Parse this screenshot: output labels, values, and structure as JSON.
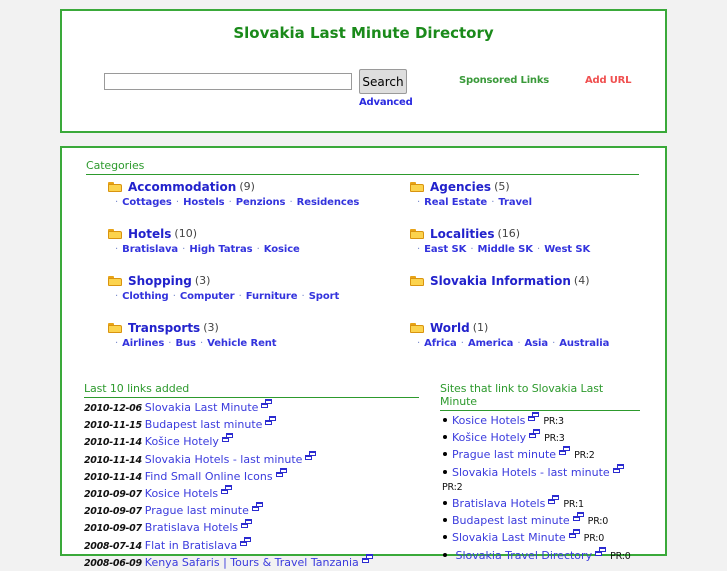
{
  "header": {
    "title": "Slovakia Last Minute Directory",
    "search": {
      "value": "",
      "placeholder": "",
      "button_label": "Search",
      "advanced_label": "Advanced"
    },
    "sponsored_links_label": "Sponsored Links",
    "add_url_label": "Add URL"
  },
  "content": {
    "categories_heading": "Categories",
    "categories_left": [
      {
        "name": "Accommodation",
        "count": "(9)",
        "subcategories": [
          "Cottages",
          "Hostels",
          "Penzions",
          "Residences"
        ]
      },
      {
        "name": "Hotels",
        "count": "(10)",
        "subcategories": [
          "Bratislava",
          "High Tatras",
          "Kosice"
        ]
      },
      {
        "name": "Shopping",
        "count": "(3)",
        "subcategories": [
          "Clothing",
          "Computer",
          "Furniture",
          "Sport"
        ]
      },
      {
        "name": "Transports",
        "count": "(3)",
        "subcategories": [
          "Airlines",
          "Bus",
          "Vehicle Rent"
        ]
      }
    ],
    "categories_right": [
      {
        "name": "Agencies",
        "count": "(5)",
        "subcategories": [
          "Real Estate",
          "Travel"
        ]
      },
      {
        "name": "Localities",
        "count": "(16)",
        "subcategories": [
          "East SK",
          "Middle SK",
          "West SK"
        ]
      },
      {
        "name": "Slovakia Information",
        "count": "(4)",
        "subcategories": []
      },
      {
        "name": "World",
        "count": "(1)",
        "subcategories": [
          "Africa",
          "America",
          "Asia",
          "Australia"
        ]
      }
    ],
    "latest_heading": "Last 10 links added",
    "latest_links": [
      {
        "date": "2010-12-06",
        "title": "Slovakia Last Minute"
      },
      {
        "date": "2010-11-15",
        "title": "Budapest last minute"
      },
      {
        "date": "2010-11-14",
        "title": "Košice Hotely"
      },
      {
        "date": "2010-11-14",
        "title": "Slovakia Hotels - last minute"
      },
      {
        "date": "2010-11-14",
        "title": "Find Small Online Icons"
      },
      {
        "date": "2010-09-07",
        "title": "Kosice Hotels"
      },
      {
        "date": "2010-09-07",
        "title": "Prague last minute"
      },
      {
        "date": "2010-09-07",
        "title": "Bratislava Hotels"
      },
      {
        "date": "2008-07-14",
        "title": "Flat in Bratislava"
      },
      {
        "date": "2008-06-09",
        "title": "Kenya Safaris | Tours & Travel Tanzania"
      }
    ],
    "backlinks_heading": "Sites that link to Slovakia Last Minute",
    "backlinks": [
      {
        "title": "Kosice Hotels",
        "pr": "PR:3"
      },
      {
        "title": "Košice Hotely",
        "pr": "PR:3"
      },
      {
        "title": "Prague last minute",
        "pr": "PR:2"
      },
      {
        "title": "Slovakia Hotels - last minute",
        "pr": "PR:2"
      },
      {
        "title": "Bratislava Hotels",
        "pr": "PR:1"
      },
      {
        "title": "Budapest last minute",
        "pr": "PR:0"
      },
      {
        "title": "Slovakia Last Minute",
        "pr": "PR:0"
      },
      {
        "title": " Slovakia Travel Directory",
        "pr": "PR:0"
      }
    ]
  },
  "colors": {
    "page_background": "#f2f2f2",
    "panel_border": "#3aa93a",
    "title_green": "#1a8a1a",
    "heading_green": "#2d9a2d",
    "link_blue": "#3b3bdd",
    "add_url_red": "#f05050",
    "folder_yellow": "#fcd34d"
  },
  "icons": {
    "folder": "folder-icon",
    "window": "cascading-windows-icon"
  }
}
